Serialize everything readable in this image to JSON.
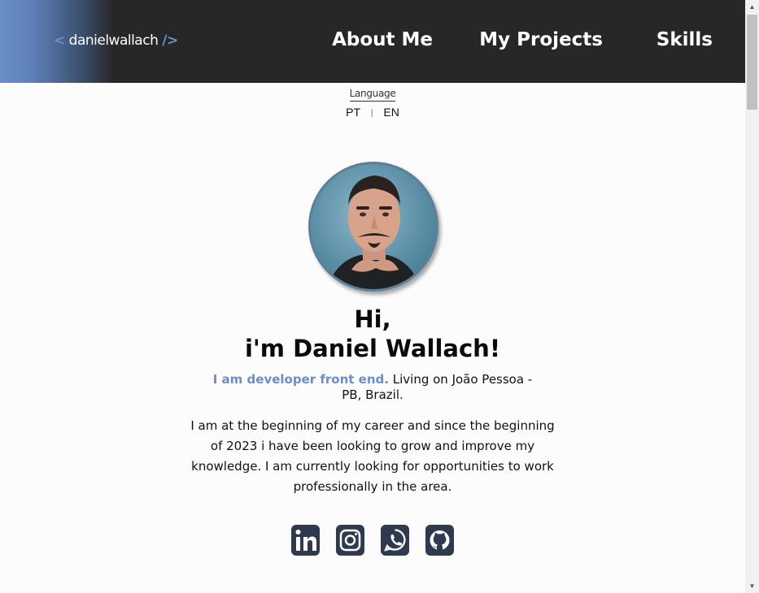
{
  "header": {
    "logo": {
      "open": "<",
      "name": "danielwallach",
      "close": "/>"
    },
    "nav": [
      {
        "label": "About Me"
      },
      {
        "label": "My Projects"
      },
      {
        "label": "Skills"
      }
    ]
  },
  "language": {
    "title": "Language",
    "options": [
      "PT",
      "EN"
    ],
    "separator": "|"
  },
  "hero": {
    "greeting": "Hi,",
    "name": "i'm Daniel Wallach!",
    "role": "I am developer front end.",
    "location": "Living on João Pessoa - PB, Brazil.",
    "bio": "I am at the beginning of my career and since the beginning of 2023 i have been looking to grow and improve my knowledge. I am currently looking for opportunities to work professionally in the area."
  },
  "socials": [
    {
      "icon": "linkedin-icon"
    },
    {
      "icon": "instagram-icon"
    },
    {
      "icon": "whatsapp-icon"
    },
    {
      "icon": "github-icon"
    }
  ],
  "colors": {
    "accent": "#6a8ec8",
    "header_bg": "#272727",
    "icon": "#2f3a4f"
  }
}
